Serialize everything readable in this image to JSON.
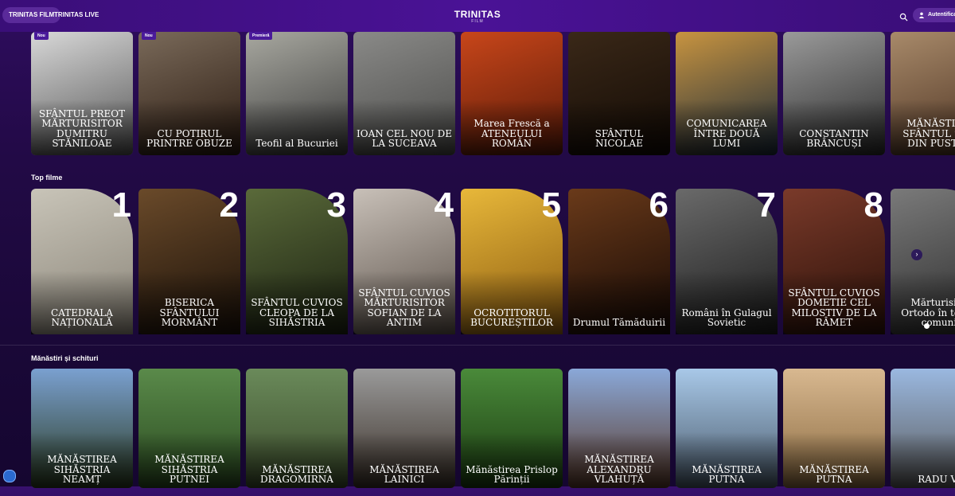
{
  "header": {
    "tabs": [
      "TRINITAS FILM",
      "TRINITAS LIVE"
    ],
    "logo_main": "TRINITAS",
    "logo_sub": "FILM",
    "auth_label": "Autentificare"
  },
  "row1": {
    "cards": [
      {
        "badge": "Nou",
        "title": "SFÂNTUL PREOT MĂRTURISITOR DUMITRU STĂNILOAE",
        "colors": [
          "#d8d8d8",
          "#555"
        ]
      },
      {
        "badge": "Nou",
        "title": "CU POTIRUL PRINTRE OBUZE",
        "colors": [
          "#7a6a5a",
          "#2a1a10"
        ]
      },
      {
        "badge": "Premieră",
        "title": "Teofil al Bucuriei",
        "colors": [
          "#a8a8a0",
          "#3a3a3a"
        ]
      },
      {
        "badge": "",
        "title": "IOAN CEL NOU DE LA SUCEAVA",
        "colors": [
          "#8a8a88",
          "#4a4a48"
        ]
      },
      {
        "badge": "",
        "title": "Marea Frescă a ATENEULUI ROMÂN",
        "colors": [
          "#c8461a",
          "#5a1a08"
        ]
      },
      {
        "badge": "",
        "title": "SFÂNTUL NICOLAE",
        "colors": [
          "#3a2818",
          "#120a04"
        ]
      },
      {
        "badge": "",
        "title": "COMUNICAREA ÎNTRE DOUĂ LUMI",
        "colors": [
          "#c89440",
          "#1a2a3a"
        ]
      },
      {
        "badge": "",
        "title": "CONSTANTIN BRÂNCUȘI",
        "colors": [
          "#9a9a9a",
          "#2a2a2a"
        ]
      },
      {
        "badge": "",
        "title": "MĂNĂSTIREA SFÂNTUL SAVA DIN PUSTIUL",
        "colors": [
          "#a88a6a",
          "#4a3020"
        ]
      }
    ]
  },
  "top": {
    "title": "Top filme",
    "cards": [
      {
        "rank": "1",
        "title": "CATEDRALA NAȚIONALĂ",
        "colors": [
          "#c8c4b8",
          "#8a8478"
        ]
      },
      {
        "rank": "2",
        "title": "BISERICA SFÂNTULUI MORMÂNT",
        "colors": [
          "#6a4a2a",
          "#1a1008"
        ]
      },
      {
        "rank": "3",
        "title": "SFÂNTUL CUVIOS CLEOPA DE LA SIHĂSTRIA",
        "colors": [
          "#5a6a3a",
          "#1a2010"
        ]
      },
      {
        "rank": "4",
        "title": "SFÂNTUL CUVIOS MĂRTURISITOR SOFIAN DE LA ANTIM",
        "colors": [
          "#c8c0b8",
          "#5a5048"
        ]
      },
      {
        "rank": "5",
        "title": "OCROTITORUL BUCUREȘTILOR",
        "colors": [
          "#e8b83a",
          "#8a5a10"
        ]
      },
      {
        "rank": "6",
        "title": "Drumul Tămăduirii",
        "colors": [
          "#6a3a1a",
          "#140804"
        ]
      },
      {
        "rank": "7",
        "title": "Români în Gulagul Sovietic",
        "colors": [
          "#6a6a6a",
          "#1a1a1a"
        ]
      },
      {
        "rank": "8",
        "title": "SFÂNTUL CUVIOS DOMETIE CEL MILOSTIV DE LA RÂMET",
        "colors": [
          "#7a3a2a",
          "#2a1008"
        ]
      },
      {
        "rank": "",
        "title": "Mărturisit ai Ortodo în temniț comunis",
        "colors": [
          "#7a7a7a",
          "#2a2a2a"
        ]
      }
    ]
  },
  "monasteries": {
    "title": "Mănăstiri și schituri",
    "cards": [
      {
        "title": "MĂNĂSTIREA SIHĂSTRIA NEAMȚ",
        "colors": [
          "#7aa0d0",
          "#2a3a20"
        ]
      },
      {
        "title": "MĂNĂSTIREA SIHĂSTRIA PUTNEI",
        "colors": [
          "#5a8a4a",
          "#2a4a20"
        ]
      },
      {
        "title": "MĂNĂSTIREA DRAGOMIRNA",
        "colors": [
          "#6a8a5a",
          "#3a4a2a"
        ]
      },
      {
        "title": "MĂNĂSTIREA LAINICI",
        "colors": [
          "#9a9a9a",
          "#3a3028"
        ]
      },
      {
        "title": "Mănăstirea Prislop Părinții",
        "colors": [
          "#4a8a3a",
          "#1a3a10"
        ]
      },
      {
        "title": "MĂNĂSTIREA ALEXANDRU VLAHUȚĂ",
        "colors": [
          "#8aa8d8",
          "#5a3a2a"
        ]
      },
      {
        "title": "MĂNĂSTIREA PUTNA",
        "colors": [
          "#a8c8e8",
          "#4a5a6a"
        ]
      },
      {
        "title": "MĂNĂSTIREA PUTNA",
        "colors": [
          "#d8b890",
          "#8a6a40"
        ]
      },
      {
        "title": "RADU VO",
        "colors": [
          "#9ab8e0",
          "#5a5a5a"
        ]
      }
    ]
  }
}
